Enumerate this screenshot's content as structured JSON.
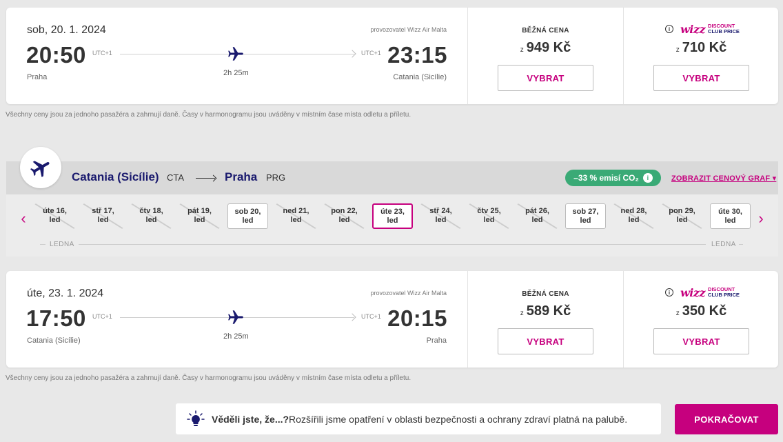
{
  "outbound": {
    "date": "sob, 20. 1. 2024",
    "operator": "provozovatel Wizz Air Malta",
    "dep_time": "20:50",
    "dep_tz": "UTC+1",
    "arr_time": "23:15",
    "arr_tz": "UTC+1",
    "duration": "2h 25m",
    "dep_city": "Praha",
    "arr_city": "Catania (Sicílie)",
    "regular_label": "BĚŽNÁ CENA",
    "regular_from": "z",
    "regular_price": "949 Kč",
    "club_from": "z",
    "club_price": "710 Kč",
    "select_label": "VYBRAT"
  },
  "club_logo": {
    "info": "i",
    "wizz": "wizz",
    "line1": "DISCOUNT",
    "line2": "CLUB PRICE"
  },
  "price_note": "Všechny ceny jsou za jednoho pasažéra a zahrnují daně. Časy v harmonogramu jsou uváděny v místním čase místa odletu a příletu.",
  "route": {
    "from_city": "Catania (Sicílie)",
    "from_code": "CTA",
    "to_city": "Praha",
    "to_code": "PRG",
    "co2_badge": "–33 % emisí CO₂",
    "co2_info": "i",
    "price_graph_link": "ZOBRAZIT CENOVÝ GRAF ▾"
  },
  "date_strip": {
    "prev_icon": "‹",
    "next_icon": "›",
    "month_left": "LEDNA",
    "month_right": "LEDNA",
    "days": [
      {
        "l1": "úte 16,",
        "l2": "led",
        "state": "slashed"
      },
      {
        "l1": "stř 17,",
        "l2": "led",
        "state": "slashed"
      },
      {
        "l1": "čtv 18,",
        "l2": "led",
        "state": "slashed"
      },
      {
        "l1": "pát 19,",
        "l2": "led",
        "state": "slashed"
      },
      {
        "l1": "sob 20,",
        "l2": "led",
        "state": "available"
      },
      {
        "l1": "ned 21,",
        "l2": "led",
        "state": "slashed"
      },
      {
        "l1": "pon 22,",
        "l2": "led",
        "state": "slashed"
      },
      {
        "l1": "úte 23,",
        "l2": "led",
        "state": "selected"
      },
      {
        "l1": "stř 24,",
        "l2": "led",
        "state": "slashed"
      },
      {
        "l1": "čtv 25,",
        "l2": "led",
        "state": "slashed"
      },
      {
        "l1": "pát 26,",
        "l2": "led",
        "state": "slashed"
      },
      {
        "l1": "sob 27,",
        "l2": "led",
        "state": "available"
      },
      {
        "l1": "ned 28,",
        "l2": "led",
        "state": "slashed"
      },
      {
        "l1": "pon 29,",
        "l2": "led",
        "state": "slashed"
      },
      {
        "l1": "úte 30,",
        "l2": "led",
        "state": "available"
      }
    ]
  },
  "return": {
    "date": "úte, 23. 1. 2024",
    "operator": "provozovatel Wizz Air Malta",
    "dep_time": "17:50",
    "dep_tz": "UTC+1",
    "arr_time": "20:15",
    "arr_tz": "UTC+1",
    "duration": "2h 25m",
    "dep_city": "Catania (Sicílie)",
    "arr_city": "Praha",
    "regular_label": "BĚŽNÁ CENA",
    "regular_from": "z",
    "regular_price": "589 Kč",
    "club_from": "z",
    "club_price": "350 Kč",
    "select_label": "VYBRAT"
  },
  "tip": {
    "bold": "Věděli jste, že...?",
    "text": "Rozšířili jsme opatření v oblasti bezpečnosti a ochrany zdraví platná na palubě."
  },
  "continue_label": "POKRAČOVAT",
  "colors": {
    "brand": "#c6007e",
    "navy": "#1a1a6e",
    "co2_green": "#3aaa76"
  }
}
